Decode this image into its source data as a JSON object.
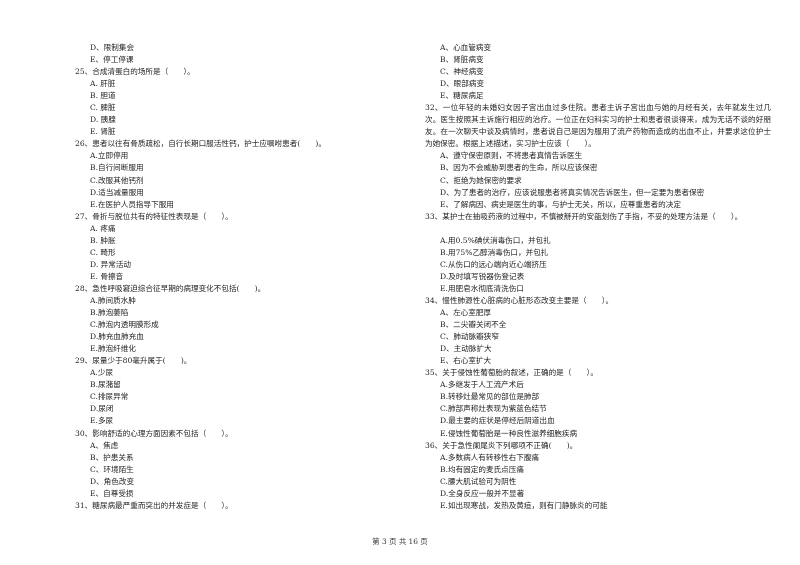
{
  "left_column": [
    {
      "kind": "opt",
      "text": "D、限制集会"
    },
    {
      "kind": "opt",
      "text": "E、停工停课"
    },
    {
      "kind": "q",
      "text": "25、合成清蛋白的场所是（　　）。"
    },
    {
      "kind": "opt",
      "text": "A. 肝脏"
    },
    {
      "kind": "opt",
      "text": "B. 胆道"
    },
    {
      "kind": "opt",
      "text": "C. 脾脏"
    },
    {
      "kind": "opt",
      "text": "D. 胰腺"
    },
    {
      "kind": "opt",
      "text": "E. 肾脏"
    },
    {
      "kind": "q",
      "text": "26、患者以往有骨质疏松，自行长期口服活性钙，护士应嘱咐患者(　　)。"
    },
    {
      "kind": "opt",
      "text": "A.立即停用"
    },
    {
      "kind": "opt",
      "text": "B.自行间断服用"
    },
    {
      "kind": "opt",
      "text": "C.改服其他钙剂"
    },
    {
      "kind": "opt",
      "text": "D.适当减量服用"
    },
    {
      "kind": "opt",
      "text": "E.在医护人员指导下服用"
    },
    {
      "kind": "q",
      "text": "27、骨折与脱位共有的特征性表现是（　　）。"
    },
    {
      "kind": "opt",
      "text": "A. 疼痛"
    },
    {
      "kind": "opt",
      "text": "B. 肿胀"
    },
    {
      "kind": "opt",
      "text": "C. 畸形"
    },
    {
      "kind": "opt",
      "text": "D. 异常活动"
    },
    {
      "kind": "opt",
      "text": "E. 骨擦音"
    },
    {
      "kind": "q",
      "text": "28、急性呼吸窘迫综合征早期的病理变化不包括(　　)。"
    },
    {
      "kind": "opt",
      "text": "A.肺间质水肿"
    },
    {
      "kind": "opt",
      "text": "B.肺泡萎陷"
    },
    {
      "kind": "opt",
      "text": "C.肺泡内透明膜形成"
    },
    {
      "kind": "opt",
      "text": "D.肺充血肺充血"
    },
    {
      "kind": "opt",
      "text": "E.肺泡纤维化"
    },
    {
      "kind": "q",
      "text": "29、尿量少于80毫升属于(　　)。"
    },
    {
      "kind": "opt",
      "text": "A.少尿"
    },
    {
      "kind": "opt",
      "text": "B.尿潴留"
    },
    {
      "kind": "opt",
      "text": "C.排尿异常"
    },
    {
      "kind": "opt",
      "text": "D.尿闭"
    },
    {
      "kind": "opt",
      "text": "E.多尿"
    },
    {
      "kind": "q",
      "text": "30、影响舒适的心理方面因素不包括（　　）。"
    },
    {
      "kind": "opt",
      "text": "A、焦虑"
    },
    {
      "kind": "opt",
      "text": "B、护患关系"
    },
    {
      "kind": "opt",
      "text": "C、环境陌生"
    },
    {
      "kind": "opt",
      "text": "D、角色改变"
    },
    {
      "kind": "opt",
      "text": "E、自尊受损"
    },
    {
      "kind": "q",
      "text": "31、糖尿病最严重而突出的并发症是（　　）。"
    }
  ],
  "right_column": [
    {
      "kind": "opt",
      "text": "A、心血管病变"
    },
    {
      "kind": "opt",
      "text": "B、肾脏病变"
    },
    {
      "kind": "opt",
      "text": "C、神经病变"
    },
    {
      "kind": "opt",
      "text": "D、眼部病变"
    },
    {
      "kind": "opt",
      "text": "E、糖尿病足"
    },
    {
      "kind": "q4",
      "text": "32、一位年轻的未婚妇女因子宫出血过多住院。患者主诉子宫出血与她的月经有关，去年就发生过几次。医生按照其主诉施行相应的治疗。一位正在妇科实习的护士和患者很谈得来，成为无话不谈的好朋友。在一次聊天中谈及病情时，患者说自己是因为服用了流产药物而造成的出血不止，并要求这位护士为她保密。根据上述描述，实习护士应该（　　）。"
    },
    {
      "kind": "opt",
      "text": "A、遵守保密原则，不将患者真情告诉医生"
    },
    {
      "kind": "opt",
      "text": "B、因为不会威胁到患者的生命，所以应该保密"
    },
    {
      "kind": "opt",
      "text": "C、拒绝为她保密的要求"
    },
    {
      "kind": "opt",
      "text": "D、为了患者的治疗，应该说服患者将真实情况告诉医生，但一定要为患者保密"
    },
    {
      "kind": "opt",
      "text": "E、了解病因、病史是医生的事，与护士无关，所以，应尊重患者的决定"
    },
    {
      "kind": "q",
      "text": "33、某护士在抽吸药液的过程中，不慎被掰开的安瓿划伤了手指，不妥的处理方法是（　　）。"
    },
    {
      "kind": "blank",
      "text": ""
    },
    {
      "kind": "opt",
      "text": "A.用0.5%碘伏消毒伤口，并包扎"
    },
    {
      "kind": "opt",
      "text": "B.用75%乙醇消毒伤口，并包扎"
    },
    {
      "kind": "opt",
      "text": "C.从伤口的远心端向近心端挤压"
    },
    {
      "kind": "opt",
      "text": "D.及时填写锐器伤登记表"
    },
    {
      "kind": "opt",
      "text": "E.用肥皂水彻底清洗伤口"
    },
    {
      "kind": "q",
      "text": "34、慢性肺源性心脏病的心脏形态改变主要是（　　）。"
    },
    {
      "kind": "opt",
      "text": "A、左心室肥厚"
    },
    {
      "kind": "opt",
      "text": "B、二尖瓣关闭不全"
    },
    {
      "kind": "opt",
      "text": "C、肺动脉瓣狭窄"
    },
    {
      "kind": "opt",
      "text": "D、主动脉扩大"
    },
    {
      "kind": "opt",
      "text": "E、右心室扩大"
    },
    {
      "kind": "q",
      "text": "35、关于侵蚀性葡萄胎的叙述，正确的是（　　）。"
    },
    {
      "kind": "opt",
      "text": "A.多继发于人工流产术后"
    },
    {
      "kind": "opt",
      "text": "B.转移灶最常见的部位是肺部"
    },
    {
      "kind": "opt",
      "text": "C.肺部声称灶表现为紫蓝色结节"
    },
    {
      "kind": "opt",
      "text": "D.最主要的症状是停经后阴道出血"
    },
    {
      "kind": "opt",
      "text": "E.侵蚀性葡萄胎是一种良性滋养细胞疾病"
    },
    {
      "kind": "q",
      "text": "36、关于急性阑尾炎下列哪项不正确(　　)。"
    },
    {
      "kind": "opt",
      "text": "A.多数病人有转移性右下腹痛"
    },
    {
      "kind": "opt",
      "text": "B.均有固定的麦氏点压痛"
    },
    {
      "kind": "opt",
      "text": "C.腰大肌试验可为阴性"
    },
    {
      "kind": "opt",
      "text": "D.全身反应一般并不显著"
    },
    {
      "kind": "opt",
      "text": "E.如出现寒战，发热及黄疸，则有门静脉炎的可能"
    }
  ],
  "footer": {
    "page_label": "第 3 页 共 16 页"
  }
}
